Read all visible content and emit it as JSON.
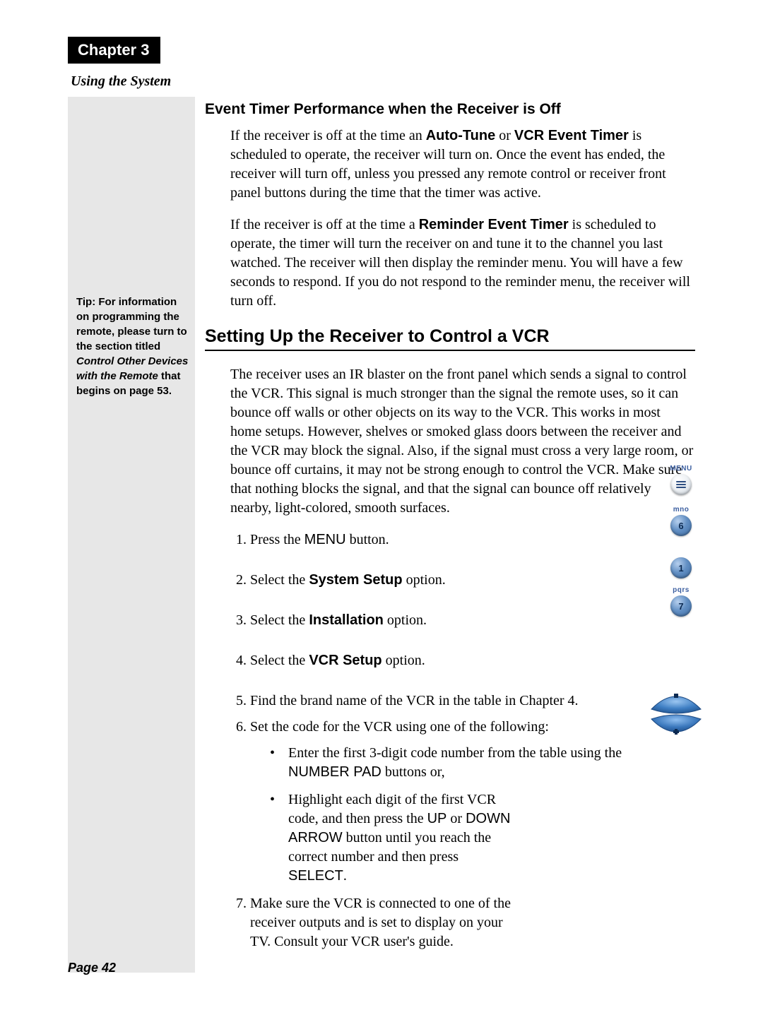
{
  "chapterLabel": "Chapter 3",
  "subhead": "Using the System",
  "sidebar": {
    "tip_prefix": "Tip: For information on programming the remote, please turn to the section titled ",
    "tip_italic": "Control Other Devices with the Remote",
    "tip_suffix": " that begins on page 53."
  },
  "section1": {
    "heading": "Event Timer Performance when the Receiver is Off",
    "p1_a": "If the receiver is off at the time an ",
    "p1_b1": "Auto-Tune",
    "p1_mid": " or ",
    "p1_b2": "VCR Event Timer",
    "p1_c": " is scheduled to operate, the receiver will turn on. Once the event has ended, the receiver will turn off, unless you pressed any remote control or receiver front panel buttons during the time that the timer was active.",
    "p2_a": "If the receiver is off at the time a ",
    "p2_b": "Reminder Event Timer",
    "p2_c": " is scheduled to operate, the timer will turn the receiver on and tune it to the channel you last watched. The receiver will then display the reminder menu. You will have a few seconds to respond. If you do not respond to the reminder menu, the receiver will turn off."
  },
  "section2": {
    "heading": "Setting Up the Receiver to Control a VCR",
    "intro": "The receiver uses an IR blaster on the front panel which sends a signal to control the VCR. This signal is much stronger than the signal the remote uses, so it can bounce off walls or other objects on its way to the VCR. This works in most home setups. However, shelves or smoked glass doors between the receiver and the VCR may block the signal. Also, if the signal must cross a very large room, or bounce off curtains, it may not be strong enough to control the VCR. Make sure that nothing blocks the signal, and that the signal can bounce off relatively nearby, light-colored, smooth surfaces.",
    "steps": {
      "s1_a": "Press the ",
      "s1_key": "MENU",
      "s1_b": " button.",
      "s2_a": "Select the ",
      "s2_bold": "System Setup",
      "s2_b": " option.",
      "s3_a": "Select the ",
      "s3_bold": "Installation",
      "s3_b": " option.",
      "s4_a": "Select the ",
      "s4_bold": "VCR Setup",
      "s4_b": " option.",
      "s5": "Find the brand name of the VCR in the table in Chapter 4.",
      "s6": "Set the code for the VCR using one of the following:",
      "s6_b1_a": "Enter the first 3-digit code number from the table using the ",
      "s6_b1_key": "NUMBER PAD",
      "s6_b1_b": " buttons or,",
      "s6_b2_a": "Highlight each digit of the first VCR code, and then press the ",
      "s6_b2_up": "UP",
      "s6_b2_or": " or ",
      "s6_b2_down": "DOWN ARROW",
      "s6_b2_b": " button until you reach the correct number and then press ",
      "s6_b2_sel": "SELECT",
      "s6_b2_dot": ".",
      "s7": "Make sure the VCR is connected to one of the receiver outputs and is set to display on your TV. Consult your VCR user's guide."
    }
  },
  "buttons": {
    "menu_label": "MENU",
    "mno_label": "mno",
    "mno_digit": "6",
    "one_digit": "1",
    "pqrs_label": "pqrs",
    "pqrs_digit": "7"
  },
  "pageNumber": "Page 42"
}
